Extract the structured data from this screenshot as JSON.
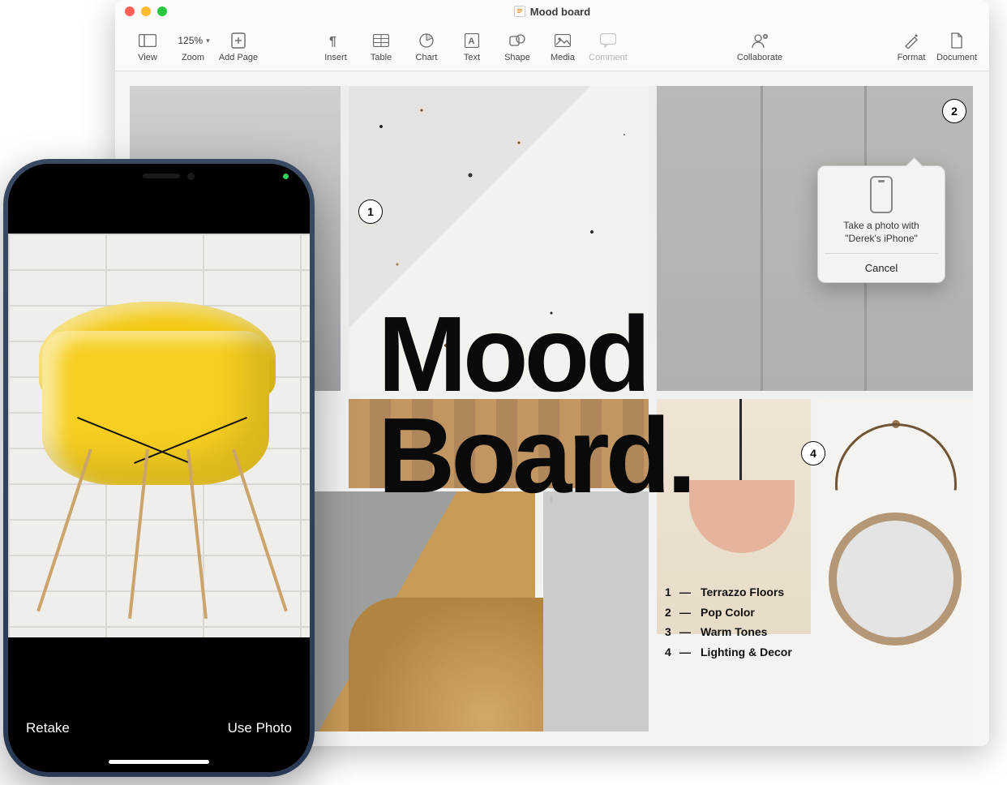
{
  "window": {
    "title": "Mood board"
  },
  "toolbar": {
    "view": "View",
    "zoom": "Zoom",
    "zoom_value": "125%",
    "add_page": "Add Page",
    "insert": "Insert",
    "table": "Table",
    "chart": "Chart",
    "text": "Text",
    "shape": "Shape",
    "media": "Media",
    "comment": "Comment",
    "collaborate": "Collaborate",
    "format": "Format",
    "document": "Document"
  },
  "document": {
    "headline_l1": "Mood",
    "headline_l2": "Board.",
    "callouts": {
      "c1": "1",
      "c2": "2",
      "c4": "4"
    },
    "legend": [
      {
        "n": "1",
        "label": "Terrazzo Floors"
      },
      {
        "n": "2",
        "label": "Pop Color"
      },
      {
        "n": "3",
        "label": "Warm Tones"
      },
      {
        "n": "4",
        "label": "Lighting & Decor"
      }
    ]
  },
  "popover": {
    "line1": "Take a photo with",
    "line2": "\"Derek's iPhone\"",
    "cancel": "Cancel"
  },
  "phone": {
    "retake": "Retake",
    "use_photo": "Use Photo"
  }
}
